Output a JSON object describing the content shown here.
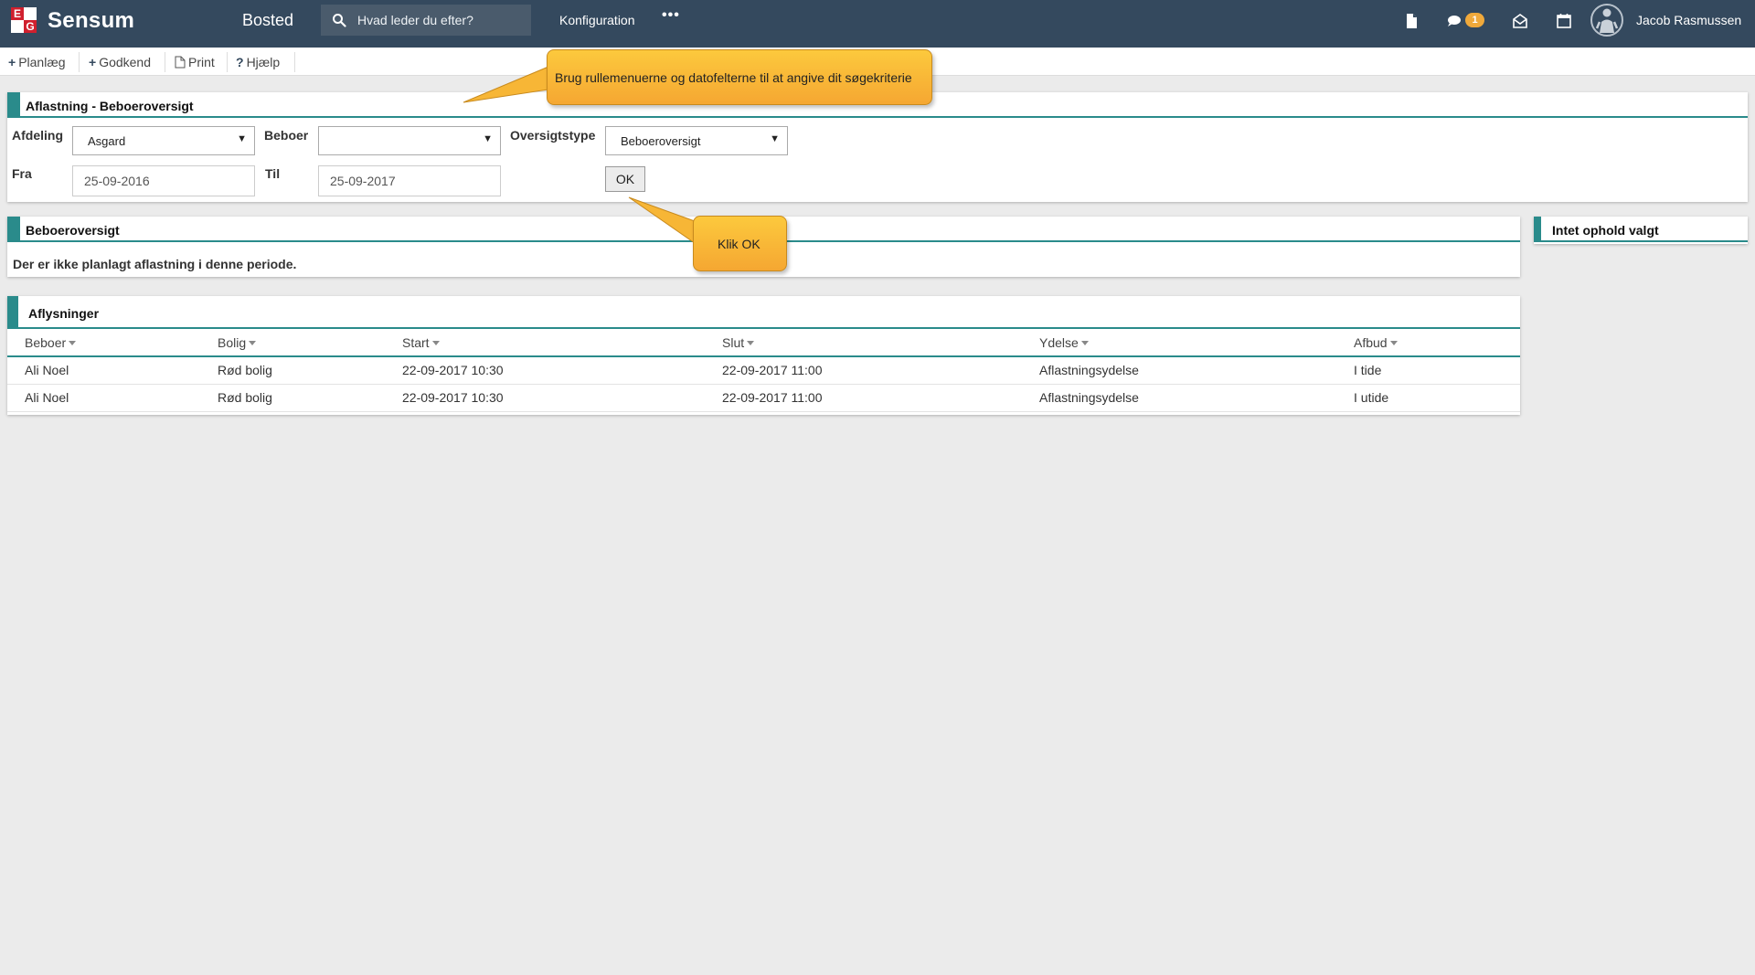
{
  "header": {
    "brand": "Sensum",
    "logo_letters": [
      "E",
      "G"
    ],
    "module": "Bosted",
    "search_placeholder": "Hvad leder du efter?",
    "config_link": "Konfiguration",
    "more": "•••",
    "notification_count": "1",
    "user_name": "Jacob Rasmussen"
  },
  "toolbar": {
    "plan": "Planlæg",
    "approve": "Godkend",
    "print": "Print",
    "help": "Hjælp"
  },
  "filter_panel": {
    "title": "Aflastning - Beboeroversigt",
    "department_label": "Afdeling",
    "department_value": "Asgard",
    "resident_label": "Beboer",
    "resident_value": "",
    "overview_label": "Oversigtstype",
    "overview_value": "Beboeroversigt",
    "from_label": "Fra",
    "from_value": "25-09-2016",
    "to_label": "Til",
    "to_value": "25-09-2017",
    "ok_label": "OK"
  },
  "overview_panel": {
    "title": "Beboeroversigt",
    "message": "Der er ikke planlagt aflastning i denne periode."
  },
  "side_panel": {
    "title": "Intet ophold valgt"
  },
  "cancellations": {
    "title": "Aflysninger",
    "columns": [
      "Beboer",
      "Bolig",
      "Start",
      "Slut",
      "Ydelse",
      "Afbud"
    ],
    "rows": [
      [
        "Ali Noel",
        "Rød bolig",
        "22-09-2017 10:30",
        "22-09-2017 11:00",
        "Aflastningsydelse",
        "I tide"
      ],
      [
        "Ali Noel",
        "Rød bolig",
        "22-09-2017 10:30",
        "22-09-2017 11:00",
        "Aflastningsydelse",
        "I utide"
      ]
    ]
  },
  "callouts": {
    "criteria_hint": "Brug rullemenuerne og datofelterne til at angive dit søgekriterie",
    "ok_hint": "Klik OK"
  },
  "colors": {
    "header_bg": "#34495e",
    "accent_teal": "#2a8b8b",
    "callout_orange": "#f5a732",
    "badge": "#f0a93b"
  },
  "icons": {
    "search": "search-icon",
    "document": "document-icon",
    "chat": "chat-icon",
    "mail": "mail-icon",
    "calendar": "calendar-icon",
    "user": "user-avatar-icon",
    "pdf": "pdf-icon"
  }
}
